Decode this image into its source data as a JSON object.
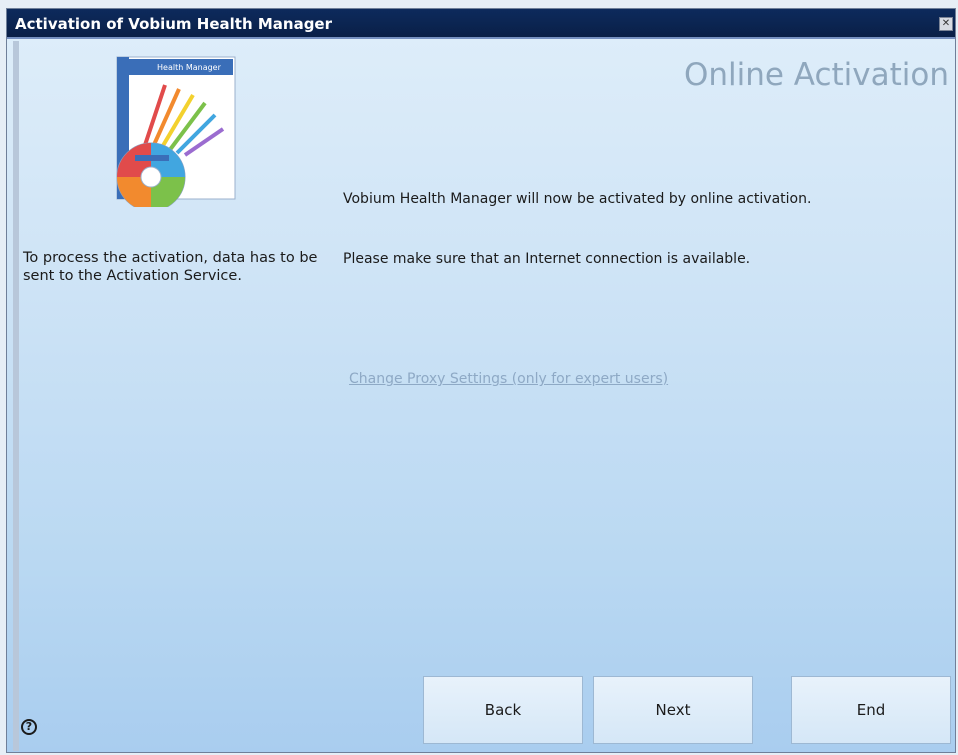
{
  "window": {
    "title": "Activation of Vobium Health Manager",
    "close_glyph": "✕"
  },
  "header": {
    "heading": "Online Activation"
  },
  "sidebar": {
    "info_text": "To process the activation, data has to be sent to the Activation Service.",
    "product_image_icon": "product-box-icon",
    "product_box_title": "Health Manager"
  },
  "main": {
    "message_1": "Vobium Health Manager will now be activated by online activation.",
    "message_2": "Please make sure that an Internet connection is available.",
    "proxy_link": "Change Proxy Settings (only for expert users)"
  },
  "footer": {
    "help_icon": "help-icon",
    "help_glyph": "?",
    "back_label": "Back",
    "next_label": "Next",
    "end_label": "End"
  },
  "colors": {
    "titlebar": "#0b2450",
    "heading": "#8fa7bd",
    "link": "#8ea9c5",
    "background_top": "#dfeefa",
    "background_bottom": "#a9cdef"
  }
}
